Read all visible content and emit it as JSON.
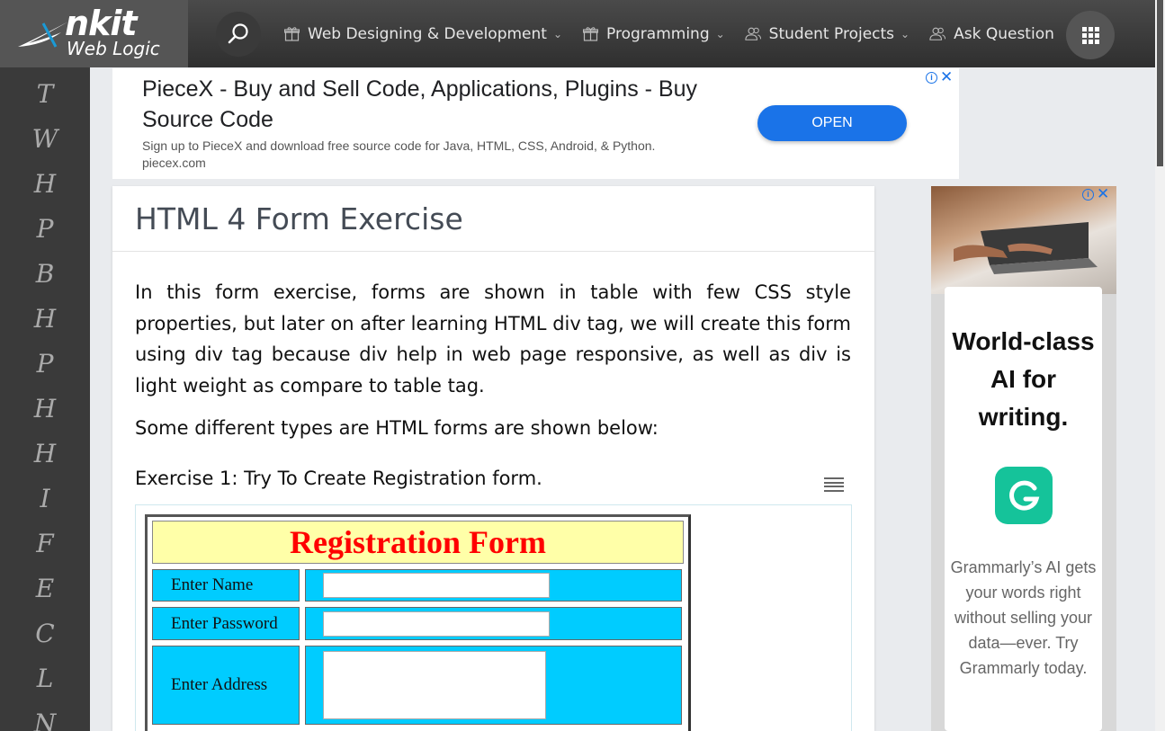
{
  "header": {
    "logo_brand": "nkit",
    "logo_sub": "Web Logic",
    "menu": [
      {
        "label": "Web Designing & Development",
        "icon": "gift-icon",
        "dropdown": true
      },
      {
        "label": "Programming",
        "icon": "gift-icon",
        "dropdown": true
      },
      {
        "label": "Student Projects",
        "icon": "users-icon",
        "dropdown": true
      },
      {
        "label": "Ask Question",
        "icon": "users-icon",
        "dropdown": false
      }
    ]
  },
  "sidebar": {
    "letters": [
      "T",
      "W",
      "H",
      "P",
      "B",
      "H",
      "P",
      "H",
      "H",
      "I",
      "F",
      "E",
      "C",
      "L",
      "N"
    ]
  },
  "ad_top": {
    "title": "PieceX - Buy and Sell Code, Applications, Plugins - Buy Source Code",
    "description": "Sign up to PieceX and download free source code for Java, HTML, CSS, Android, & Python.",
    "url": "piecex.com",
    "button": "OPEN"
  },
  "article": {
    "title": "HTML 4 Form Exercise",
    "paragraph": "In this form exercise, forms are shown in table with few CSS style properties, but later on after learning HTML div tag, we will create this form using div tag because div help in web page responsive, as well as div is light weight as compare to table tag.",
    "paragraph2": "Some different types are HTML forms are shown below:",
    "exercise_label": "Exercise 1: Try To Create Registration form."
  },
  "form": {
    "title": "Registration Form",
    "name_label": "Enter Name",
    "password_label": "Enter Password",
    "address_label": "Enter Address"
  },
  "ad_right": {
    "headline": "World-class AI for writing.",
    "body": "Grammarly’s AI gets your words right without selling your data—ever. Try Grammarly today."
  },
  "colors": {
    "nav_bg": "#3a3a3a",
    "form_title_bg": "#ffffa8",
    "form_title_color": "#ff0000",
    "form_cell_bg": "#00ccff",
    "ad_button": "#1a73e8",
    "grammarly_green": "#15c39a"
  }
}
